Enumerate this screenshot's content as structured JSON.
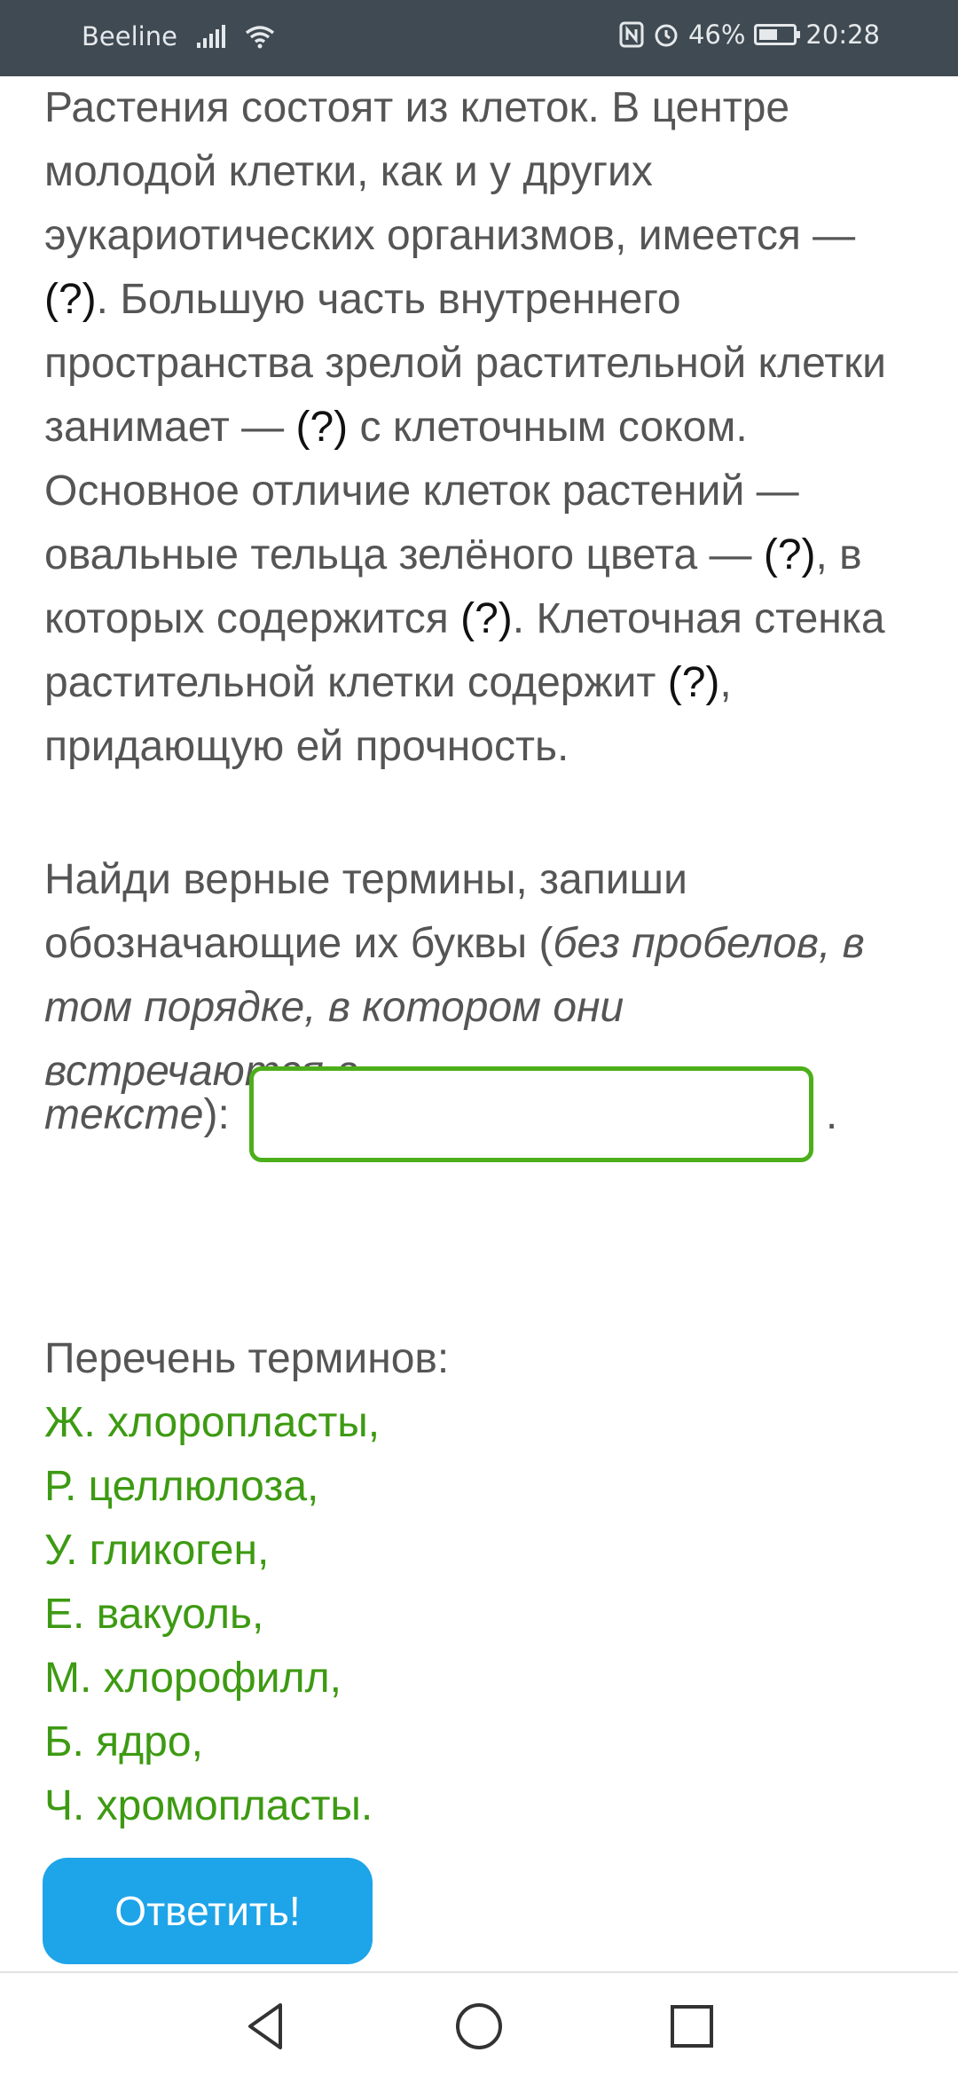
{
  "status_bar": {
    "carrier": "Beeline",
    "battery": "46%",
    "time": "20:28",
    "icons": [
      "signal-icon",
      "wifi-icon",
      "nfc-icon",
      "alarm-icon",
      "battery-icon"
    ]
  },
  "question": {
    "text_segments": [
      "Растения состоят из клеток. В центре молодой клетки, как и у других эукариотических организмов, имеется — ",
      "(?)",
      ". Большую часть внутреннего пространства зрелой растительной клетки занимает — ",
      "(?)",
      " с клеточным соком. Основное отличие клеток растений — овальные тельца зелёного цвета — ",
      "(?)",
      ", в которых содержится ",
      "(?)",
      ". Клеточная стенка растительной клетки содержит ",
      "(?)",
      ", придающую ей прочность."
    ]
  },
  "instruction": {
    "lead": "Найди верные термины, запиши обозначающие их буквы (",
    "italic": "без пробелов, в том порядке, в котором они встречаются в ",
    "italic_last": "тексте",
    "tail": "):",
    "after_input": "."
  },
  "answer_input": {
    "value": "",
    "placeholder": ""
  },
  "terms": {
    "title": "Перечень терминов:",
    "items": [
      "Ж. хлоропласты,",
      "Р. целлюлоза,",
      "У. гликоген,",
      "Е. вакуоль,",
      "М. хлорофилл,",
      "Б. ядро,",
      "Ч. хромопласты."
    ]
  },
  "submit": {
    "label": "Ответить!"
  },
  "colors": {
    "status_bar": "#3f4a52",
    "text": "#555555",
    "term_green": "#3d9a12",
    "input_border": "#4caf1a",
    "button": "#1ea4e8"
  }
}
